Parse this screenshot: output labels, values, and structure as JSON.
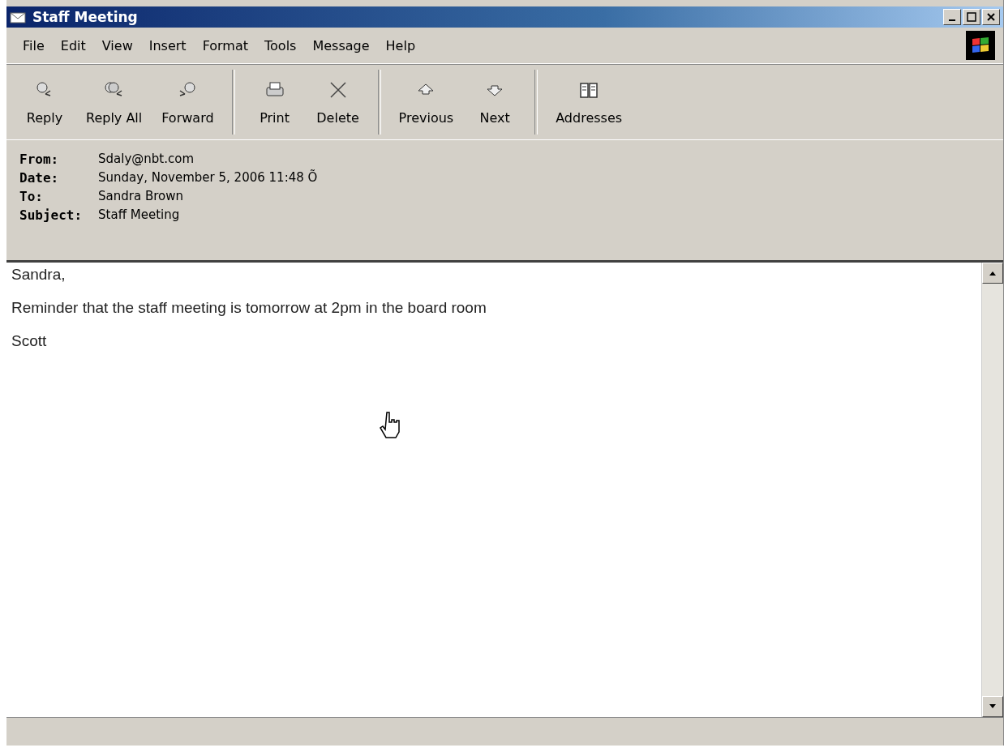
{
  "window": {
    "title": "Staff Meeting"
  },
  "menu": [
    "File",
    "Edit",
    "View",
    "Insert",
    "Format",
    "Tools",
    "Message",
    "Help"
  ],
  "toolbar": [
    {
      "label": "Reply",
      "kind": "reply"
    },
    {
      "label": "Reply All",
      "kind": "replyall"
    },
    {
      "label": "Forward",
      "kind": "forward"
    },
    {
      "label": "Print",
      "kind": "print",
      "group_start": true
    },
    {
      "label": "Delete",
      "kind": "delete"
    },
    {
      "label": "Previous",
      "kind": "previous",
      "group_start": true
    },
    {
      "label": "Next",
      "kind": "next"
    },
    {
      "label": "Addresses",
      "kind": "addresses",
      "group_start": true
    }
  ],
  "header": [
    {
      "label": "From:",
      "value": "Sdaly@nbt.com"
    },
    {
      "label": "Date:",
      "value": "Sunday, November 5, 2006 11:48 Õ"
    },
    {
      "label": "To:",
      "value": "Sandra Brown"
    },
    {
      "label": "Subject:",
      "value": "Staff Meeting"
    }
  ],
  "body": [
    "Sandra,",
    "Reminder that the staff meeting is tomorrow at 2pm in the board room",
    "Scott"
  ]
}
